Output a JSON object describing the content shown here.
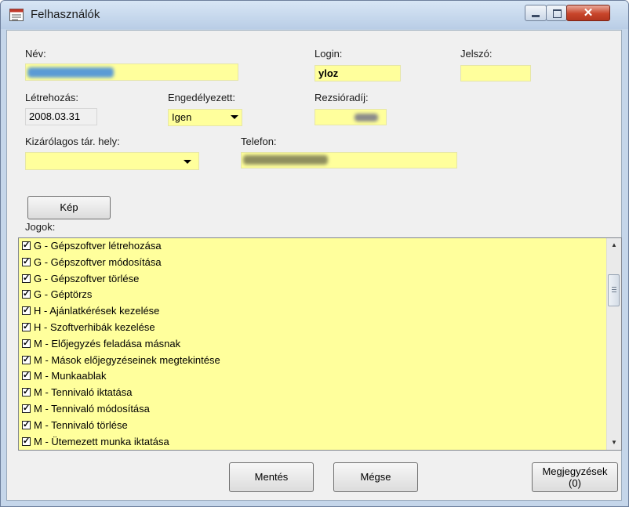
{
  "window": {
    "title": "Felhasználók"
  },
  "form": {
    "nev": {
      "label": "Név:",
      "value": ""
    },
    "login": {
      "label": "Login:",
      "value": "yloz"
    },
    "jelszo": {
      "label": "Jelszó:",
      "value": ""
    },
    "letrehozas": {
      "label": "Létrehozás:",
      "value": "2008.03.31"
    },
    "engedelyezett": {
      "label": "Engedélyezett:",
      "value": "Igen"
    },
    "rezsioradij": {
      "label": "Rezsióradíj:",
      "value": ""
    },
    "kizarolagos": {
      "label": "Kizárólagos tár. hely:",
      "value": ""
    },
    "telefon": {
      "label": "Telefon:",
      "value": ""
    }
  },
  "kep_button": "Kép",
  "jogok": {
    "label": "Jogok:",
    "items": [
      {
        "label": "G - Gépszoftver létrehozása",
        "checked": true
      },
      {
        "label": "G - Gépszoftver módosítása",
        "checked": true
      },
      {
        "label": "G - Gépszoftver törlése",
        "checked": true
      },
      {
        "label": "G - Géptörzs",
        "checked": true
      },
      {
        "label": "H - Ajánlatkérések kezelése",
        "checked": true
      },
      {
        "label": "H - Szoftverhibák kezelése",
        "checked": true
      },
      {
        "label": "M - Előjegyzés feladása másnak",
        "checked": true
      },
      {
        "label": "M - Mások előjegyzéseinek megtekintése",
        "checked": true
      },
      {
        "label": "M - Munkaablak",
        "checked": true
      },
      {
        "label": "M - Tennivaló iktatása",
        "checked": true
      },
      {
        "label": "M - Tennivaló módosítása",
        "checked": true
      },
      {
        "label": "M - Tennivaló törlése",
        "checked": true
      },
      {
        "label": "M - Ütemezett munka iktatása",
        "checked": true
      }
    ]
  },
  "buttons": {
    "mentes": "Mentés",
    "megse": "Mégse",
    "megjegyzesek": "Megjegyzések",
    "megjegyzesek_count": "(0)"
  },
  "colors": {
    "field_bg": "#ffff9c",
    "client_bg": "#f0f0f0",
    "titlebar": "#c5d6ea"
  }
}
